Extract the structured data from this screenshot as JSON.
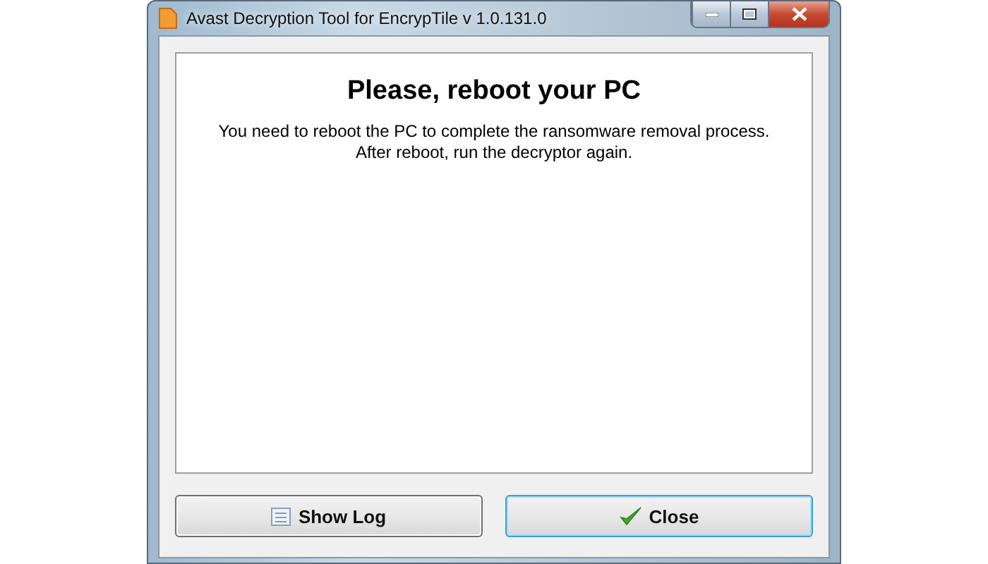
{
  "window": {
    "title": "Avast Decryption Tool for EncrypTile v 1.0.131.0"
  },
  "message": {
    "heading": "Please, reboot your PC",
    "lines": [
      "You need to reboot the PC to complete the ransomware removal process.",
      "After reboot, run the decryptor again."
    ]
  },
  "buttons": [
    {
      "label": "Show Log",
      "kind": "log",
      "focused": false
    },
    {
      "label": "Close",
      "kind": "check",
      "focused": true
    }
  ]
}
